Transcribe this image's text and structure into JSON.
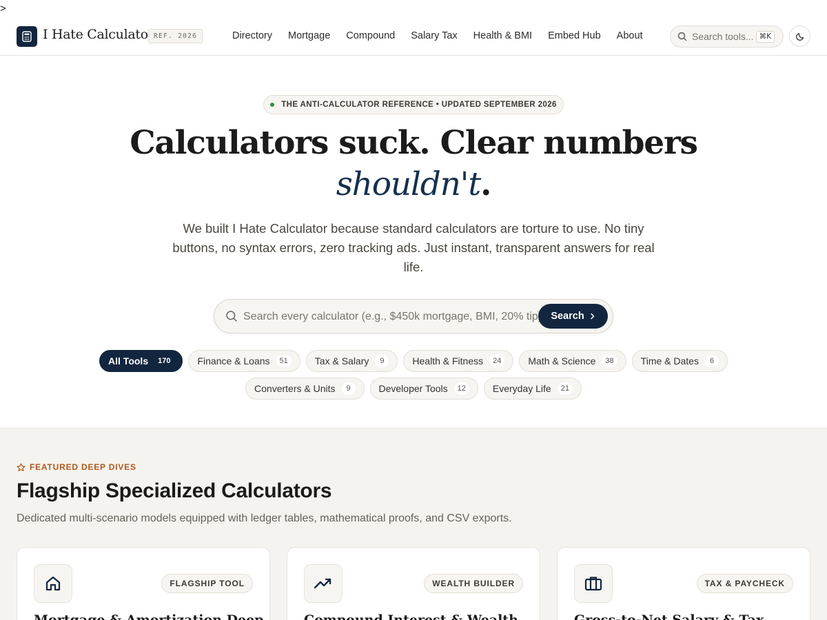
{
  "stray_char": ">",
  "header": {
    "brand": "I Hate Calculator",
    "ref_badge": "REF. 2026",
    "nav": [
      "Directory",
      "Mortgage",
      "Compound",
      "Salary Tax",
      "Health & BMI",
      "Embed Hub",
      "About"
    ],
    "search_placeholder": "Search tools...",
    "search_shortcut": "⌘K",
    "icons": {
      "logo": "calculator-icon",
      "search": "search-icon",
      "theme": "moon-icon"
    }
  },
  "hero": {
    "pill": "THE ANTI-CALCULATOR REFERENCE • UPDATED SEPTEMBER 2026",
    "title_line1": "Calculators suck. Clear numbers",
    "title_em": "shouldn't",
    "title_end": ".",
    "subtitle": "We built I Hate Calculator because standard calculators are torture to use. No tiny buttons, no syntax errors, zero tracking ads. Just instant, transparent answers for real life.",
    "search_placeholder": "Search every calculator (e.g., $450k mortgage, BMI, 20% tip)",
    "search_button": "Search"
  },
  "categories": [
    {
      "label": "All Tools",
      "count": "170",
      "active": true
    },
    {
      "label": "Finance & Loans",
      "count": "51"
    },
    {
      "label": "Tax & Salary",
      "count": "9"
    },
    {
      "label": "Health & Fitness",
      "count": "24"
    },
    {
      "label": "Math & Science",
      "count": "38"
    },
    {
      "label": "Time & Dates",
      "count": "6"
    },
    {
      "label": "Converters & Units",
      "count": "9"
    },
    {
      "label": "Developer Tools",
      "count": "12"
    },
    {
      "label": "Everyday Life",
      "count": "21"
    }
  ],
  "featured": {
    "label": "FEATURED DEEP DIVES",
    "title": "Flagship Specialized Calculators",
    "subtitle": "Dedicated multi-scenario models equipped with ledger tables, mathematical proofs, and CSV exports.",
    "cards": [
      {
        "tag": "FLAGSHIP TOOL",
        "title": "Mortgage & Amortization Deep",
        "icon": "house-icon"
      },
      {
        "tag": "WEALTH BUILDER",
        "title": "Compound Interest & Wealth",
        "icon": "trending-up-icon"
      },
      {
        "tag": "TAX & PAYCHECK",
        "title": "Gross-to-Net Salary & Tax",
        "icon": "briefcase-icon"
      }
    ]
  },
  "colors": {
    "navy": "#13263f",
    "accent_orange": "#b0571c",
    "status_green": "#2f8f46",
    "cream": "#f5f3ef"
  }
}
